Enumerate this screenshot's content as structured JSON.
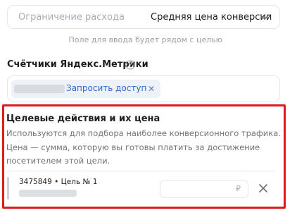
{
  "expense_limit": {
    "label": "Ограничение расхода",
    "value": "Средняя цена конверсии",
    "hint": "Поле для ввода будет рядом с целью"
  },
  "metrika": {
    "title": "Счётчики Яндекс.Метрики",
    "tag_link": "Запросить доступ"
  },
  "goals": {
    "title": "Целевые действия и их цена",
    "description": "Используются для подбора наиболее конверсионного трафика. Цена — сумма, которую вы готовы платить за достижение посетителем этой цели.",
    "items": [
      {
        "id_label": "3475849 • Цель № 1",
        "price_value": "",
        "currency": "₽"
      }
    ]
  },
  "colors": {
    "highlight_frame": "#e0191c",
    "link": "#2b6bd6"
  }
}
